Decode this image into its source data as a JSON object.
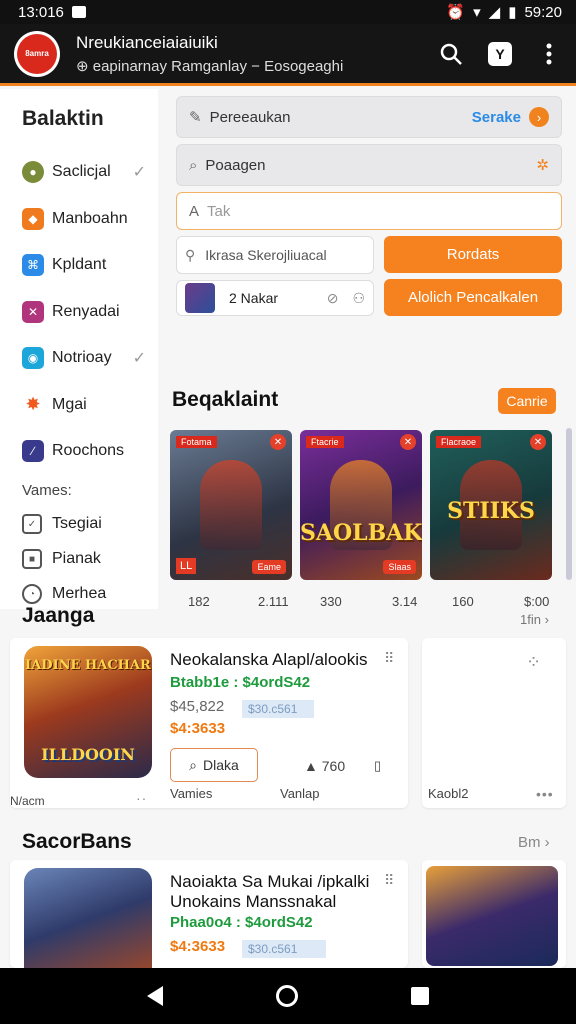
{
  "status": {
    "time": "13:016",
    "battery": "59:20"
  },
  "app": {
    "title": "Nreukianceiaiaiuiki",
    "subtitle": "⊕ eapinarnay Ramganlay − Eosogeaghi",
    "logo_text": "8amra"
  },
  "sidebar": {
    "title": "Balaktin",
    "items": [
      {
        "label": "Saclicjal",
        "icon": "avatar-icon",
        "color": "#7a8b3a",
        "check": true
      },
      {
        "label": "Manboahn",
        "icon": "box-icon",
        "color": "#f07a1e",
        "check": false
      },
      {
        "label": "Kpldant",
        "icon": "app-icon",
        "color": "#2b8be6",
        "check": false
      },
      {
        "label": "Renyadai",
        "icon": "swords-icon",
        "color": "#b0357d",
        "check": false
      },
      {
        "label": "Notrioay",
        "icon": "chat-icon",
        "color": "#1ca6d9",
        "check": true
      },
      {
        "label": "Mgai",
        "icon": "spark-icon",
        "color": "#f05a1e",
        "check": false
      },
      {
        "label": "Roochons",
        "icon": "gamepad-icon",
        "color": "#3a3a8c",
        "check": false
      }
    ],
    "section_label": "Vames:",
    "subitems": [
      {
        "label": "Tsegiai"
      },
      {
        "label": "Pianak"
      },
      {
        "label": "Merhea"
      }
    ]
  },
  "form": {
    "field1": "Pereeaukan",
    "field1_link": "Serake",
    "field2": "Poaagen",
    "field3_placeholder": "Tak",
    "field4": "Ikrasa Skerojliuacal",
    "button1": "Rordats",
    "user_name": "2 Nakar",
    "button2": "Alolich Pencalkalen"
  },
  "featured": {
    "title": "Beqaklaint",
    "pill": "Canrie",
    "cards": [
      {
        "tag": "Fotama",
        "title": "",
        "bottom": "Eame",
        "badge": "LL",
        "label_left": "182",
        "label_right": "2.111"
      },
      {
        "tag": "Ftacrie",
        "title": "SAOLBAK",
        "bottom": "Slaas",
        "badge": "",
        "label_left": "330",
        "label_right": "3.14"
      },
      {
        "tag": "Flacraoe",
        "title": "STIIKS",
        "bottom": "",
        "badge": "",
        "label_left": "160",
        "label_right": "$:00"
      }
    ],
    "more": "1fin"
  },
  "section2": {
    "title": "Jaanga",
    "item": {
      "thumb_title": "ILLDOOIN",
      "thumb_top": "IADINE HACHAR",
      "title": "Neokalanska Alapl/alookis",
      "price_green": "Btabb1e : $4ordS42",
      "old_price": "$45,822",
      "discount": "$4:3633",
      "badge": "$30.c561",
      "button": "Dlaka",
      "likes": "760",
      "foot_left": "Vamies",
      "foot_mid": "Vanlap",
      "foot_side": "Kaobl2",
      "foot_lead": "N/acm"
    }
  },
  "section3": {
    "title": "SacorBans",
    "more": "Bm",
    "item": {
      "title": "Naoiakta Sa Mukai /ipkalki",
      "title2": "Unokains Manssnakal",
      "price_green": "Phaa0o4 : $4ordS42",
      "discount": "$4:3633",
      "badge": "$30.c561"
    }
  }
}
